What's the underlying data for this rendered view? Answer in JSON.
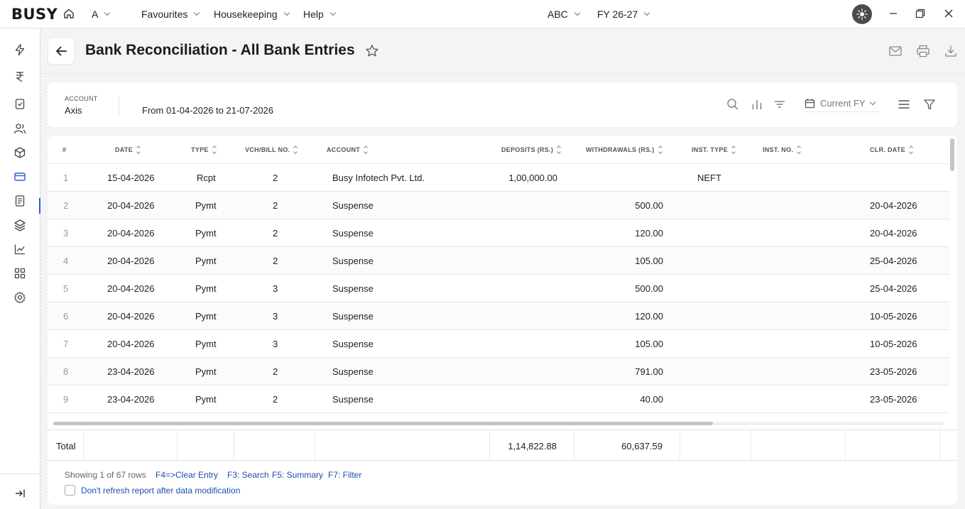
{
  "app": {
    "logo": "BUSY",
    "menu_a": "A",
    "company": "ABC",
    "fy": "FY 26-27"
  },
  "menus": {
    "favourites": "Favourites",
    "housekeeping": "Housekeeping",
    "help": "Help"
  },
  "header": {
    "title": "Bank Reconciliation - All Bank Entries"
  },
  "filters": {
    "account_caption": "ACCOUNT",
    "account_value": "Axis",
    "range": "From 01-04-2026 to 21-07-2026",
    "period": "Current FY"
  },
  "table": {
    "columns": {
      "num": "#",
      "date": "DATE",
      "type": "TYPE",
      "vch": "VCH/BILL NO.",
      "account": "ACCOUNT",
      "deposits": "DEPOSITS (RS.)",
      "withdrawals": "WITHDRAWALS (RS.)",
      "inst_type": "INST. TYPE",
      "inst_no": "INST. NO.",
      "clr_date": "CLR. DATE"
    },
    "rows": [
      {
        "num": "1",
        "date": "15-04-2026",
        "type": "Rcpt",
        "vch": "2",
        "account": "Busy Infotech Pvt. Ltd.",
        "deposit": "1,00,000.00",
        "withdrawal": "",
        "inst_type": "NEFT",
        "inst_no": "",
        "clr_date": ""
      },
      {
        "num": "2",
        "date": "20-04-2026",
        "type": "Pymt",
        "vch": "2",
        "account": "Suspense",
        "deposit": "",
        "withdrawal": "500.00",
        "inst_type": "",
        "inst_no": "",
        "clr_date": "20-04-2026"
      },
      {
        "num": "3",
        "date": "20-04-2026",
        "type": "Pymt",
        "vch": "2",
        "account": "Suspense",
        "deposit": "",
        "withdrawal": "120.00",
        "inst_type": "",
        "inst_no": "",
        "clr_date": "20-04-2026"
      },
      {
        "num": "4",
        "date": "20-04-2026",
        "type": "Pymt",
        "vch": "2",
        "account": "Suspense",
        "deposit": "",
        "withdrawal": "105.00",
        "inst_type": "",
        "inst_no": "",
        "clr_date": "25-04-2026"
      },
      {
        "num": "5",
        "date": "20-04-2026",
        "type": "Pymt",
        "vch": "3",
        "account": "Suspense",
        "deposit": "",
        "withdrawal": "500.00",
        "inst_type": "",
        "inst_no": "",
        "clr_date": "25-04-2026"
      },
      {
        "num": "6",
        "date": "20-04-2026",
        "type": "Pymt",
        "vch": "3",
        "account": "Suspense",
        "deposit": "",
        "withdrawal": "120.00",
        "inst_type": "",
        "inst_no": "",
        "clr_date": "10-05-2026"
      },
      {
        "num": "7",
        "date": "20-04-2026",
        "type": "Pymt",
        "vch": "3",
        "account": "Suspense",
        "deposit": "",
        "withdrawal": "105.00",
        "inst_type": "",
        "inst_no": "",
        "clr_date": "10-05-2026"
      },
      {
        "num": "8",
        "date": "23-04-2026",
        "type": "Pymt",
        "vch": "2",
        "account": "Suspense",
        "deposit": "",
        "withdrawal": "791.00",
        "inst_type": "",
        "inst_no": "",
        "clr_date": "23-05-2026"
      },
      {
        "num": "9",
        "date": "23-04-2026",
        "type": "Pymt",
        "vch": "2",
        "account": "Suspense",
        "deposit": "",
        "withdrawal": "40.00",
        "inst_type": "",
        "inst_no": "",
        "clr_date": "23-05-2026"
      }
    ],
    "totals": {
      "label": "Total",
      "deposits": "1,14,822.88",
      "withdrawals": "60,637.59"
    }
  },
  "footer": {
    "showing": "Showing 1 of 67 rows",
    "key_clear": "F4=>Clear Entry",
    "key_search": "F3: Search",
    "key_summary": "F5: Summary",
    "key_filter": "F7: Filter",
    "no_refresh": "Don't refresh report after data modification"
  },
  "colors": {
    "accent": "#2d5bd3",
    "link": "#1f4fa8",
    "theme_toggle_bg": "#4a4a4f"
  }
}
